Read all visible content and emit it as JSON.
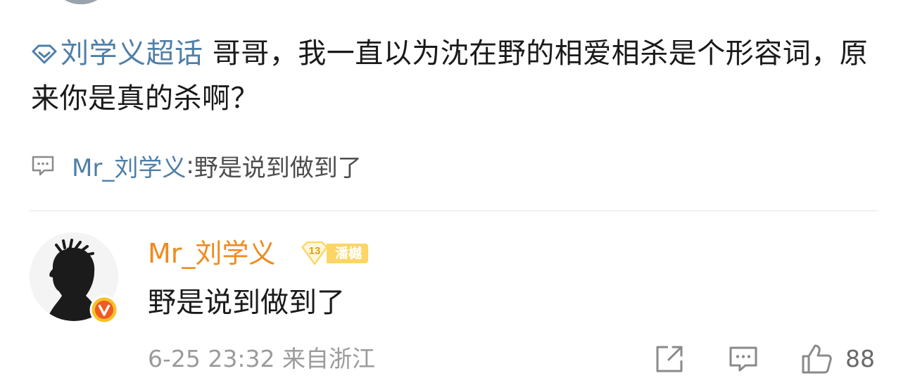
{
  "post": {
    "topic": "刘学义超话",
    "text": " 哥哥，我一直以为沈在野的相爱相杀是个形容词，原来你是真的杀啊？"
  },
  "reply_preview": {
    "user": "Mr_刘学义",
    "separator": ": ",
    "text": "野是说到做到了"
  },
  "comment": {
    "username": "Mr_刘学义",
    "badge_level": "13",
    "badge_name": "潘樾",
    "text": "野是说到做到了",
    "time": "6-25 23:32",
    "location": "来自浙江",
    "like_count": "88"
  },
  "icons": {
    "topic": "diamond-icon",
    "reply": "comment-bubble-icon",
    "share": "share-icon",
    "comment": "comment-icon",
    "like": "thumbs-up-icon",
    "verified": "verified-v-icon"
  },
  "colors": {
    "link": "#4f7fa8",
    "username": "#f08a1e",
    "badge": "#fbd565",
    "meta": "#9b9b9b"
  }
}
